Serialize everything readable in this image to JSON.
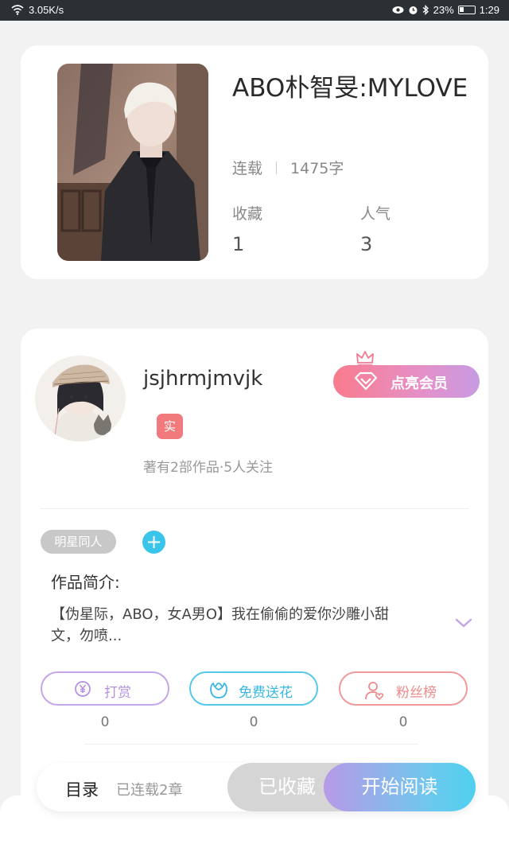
{
  "status_bar": {
    "network_speed": "3.05K/s",
    "battery": "23%",
    "time": "1:29"
  },
  "book": {
    "title": "ABO朴智旻:MYLOVE",
    "status": "连载",
    "word_count": "1475字",
    "favorites_label": "收藏",
    "favorites_value": "1",
    "popularity_label": "人气",
    "popularity_value": "3"
  },
  "author": {
    "name": "jsjhrmjmvjk",
    "real_badge": "实",
    "info": "著有2部作品·5人关注",
    "vip_button": "点亮会员"
  },
  "tags": [
    "明星同人"
  ],
  "intro": {
    "heading": "作品简介:",
    "text": "【伪星际，ABO，女A男O】我在偷偷的爱你沙雕小甜文，勿喷..."
  },
  "actions": [
    {
      "label": "打赏",
      "count": "0",
      "icon": "yen-coin-icon"
    },
    {
      "label": "免费送花",
      "count": "0",
      "icon": "flower-icon"
    },
    {
      "label": "粉丝榜",
      "count": "0",
      "icon": "fan-ranking-icon"
    }
  ],
  "bottom_bar": {
    "toc_label": "目录",
    "chapters_text": "已连载2章",
    "collected_label": "已收藏",
    "read_label": "开始阅读"
  },
  "colors": {
    "accent_blue": "#39c4ea",
    "vip_gradient_start": "#f97b8d",
    "vip_gradient_end": "#c79be2"
  }
}
